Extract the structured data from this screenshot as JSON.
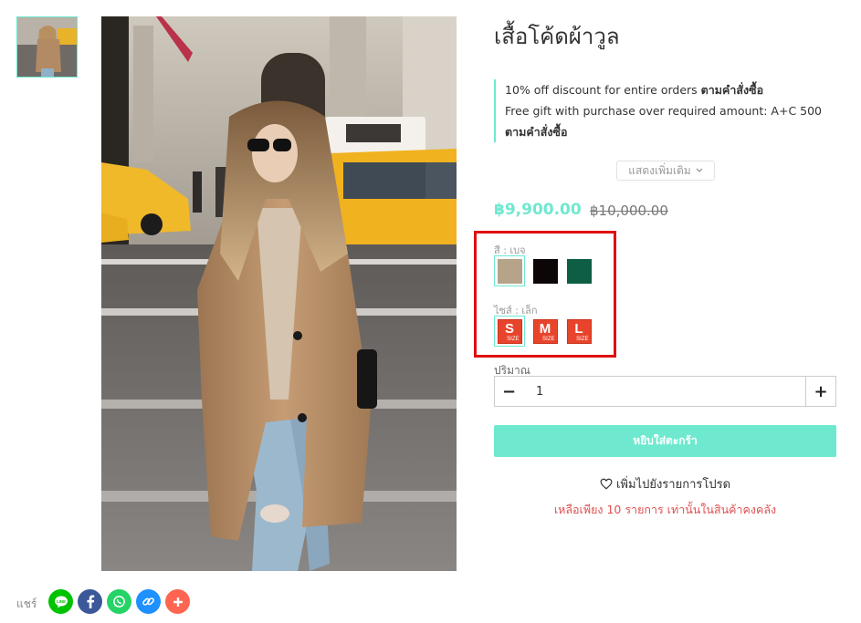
{
  "product": {
    "title": "เสื้อโค้ดผ้าวูล",
    "promo_line1_text": "10% off discount for entire orders ",
    "promo_line1_link": "ตามคำสั่งซื้อ",
    "promo_line2_text": "Free gift with purchase over required amount: A+C 500 ",
    "promo_line2_link": "ตามคำสั่งซื้อ",
    "show_more": "แสดงเพิ่มเติม",
    "price": "฿9,900.00",
    "old_price": "฿10,000.00"
  },
  "options": {
    "color_label": "สี : เบจ",
    "colors": [
      {
        "name": "beige",
        "hex": "#b5a48a",
        "selected": true
      },
      {
        "name": "black",
        "hex": "#0d0607",
        "selected": false
      },
      {
        "name": "green",
        "hex": "#0d5e45",
        "selected": false
      }
    ],
    "size_label": "ไซส์ : เล็ก",
    "sizes": [
      {
        "letter": "S",
        "tag": "SIZE",
        "selected": true
      },
      {
        "letter": "M",
        "tag": "SIZE",
        "selected": false
      },
      {
        "letter": "L",
        "tag": "SIZE",
        "selected": false
      }
    ]
  },
  "quantity": {
    "label": "ปริมาณ",
    "value": "1",
    "minus": "−",
    "plus": "+"
  },
  "actions": {
    "add_to_cart": "หยิบใส่ตะกร้า",
    "wishlist": "เพิ่มไปยังรายการโปรด",
    "stock_note": "เหลือเพียง 10 รายการ เท่านั้นในสินค้าคงคลัง"
  },
  "share": {
    "label": "แชร์",
    "buttons": [
      {
        "name": "line",
        "color": "#00c300"
      },
      {
        "name": "facebook",
        "color": "#3b5998"
      },
      {
        "name": "whatsapp",
        "color": "#25d366"
      },
      {
        "name": "copy-link",
        "color": "#1e90ff"
      },
      {
        "name": "more",
        "color": "#ff6550"
      }
    ]
  },
  "colors": {
    "accent": "#6ee9cf",
    "highlight_box": "#e01010",
    "stock_text": "#e05050"
  }
}
